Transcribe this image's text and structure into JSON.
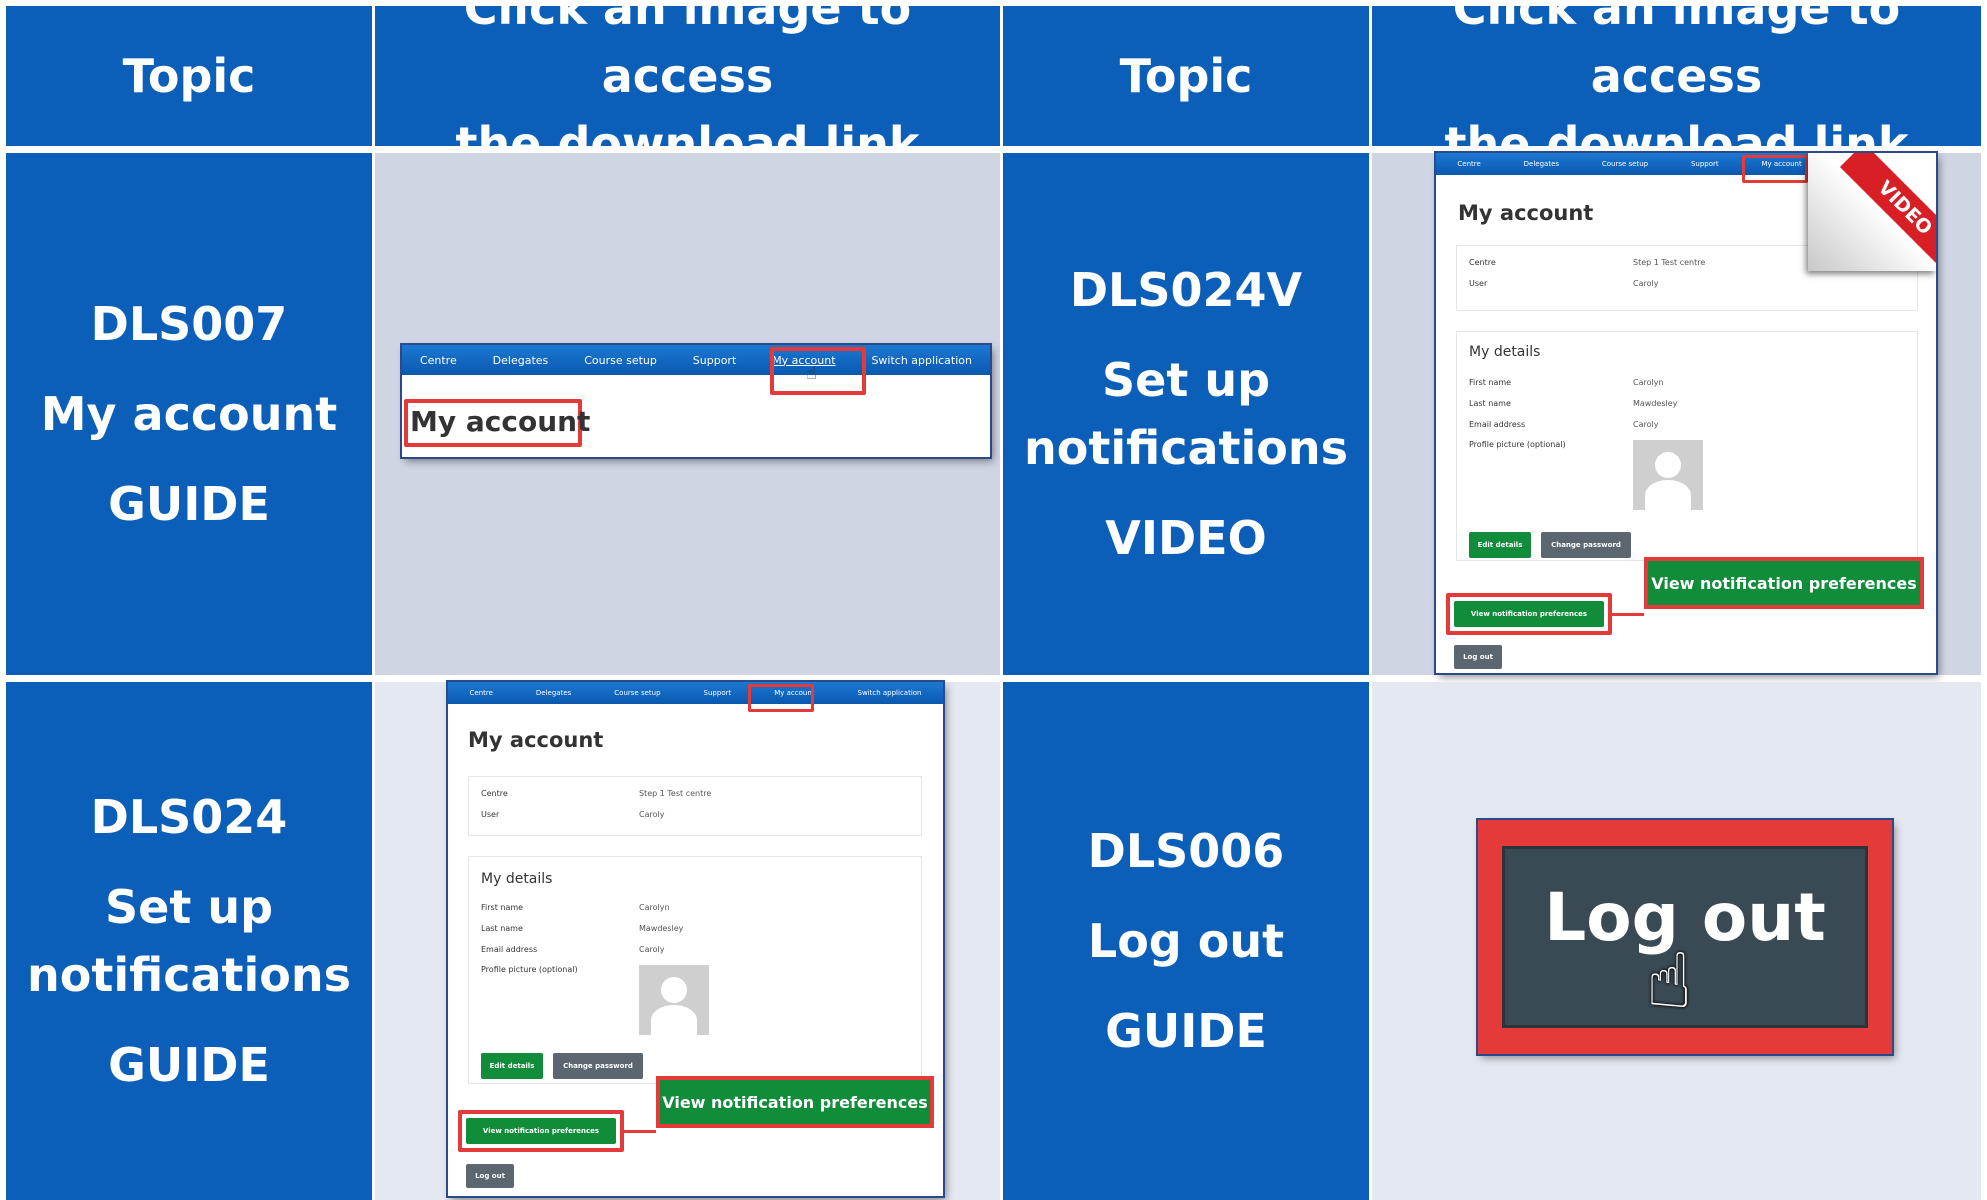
{
  "header": {
    "col1": "Topic",
    "col2_line1": "Click an image to access",
    "col2_line2": "the download link",
    "col3": "Topic",
    "col4_line1": "Click an image to access",
    "col4_line2": "the download link"
  },
  "rows": [
    {
      "code": "DLS007",
      "title_line1": "My account",
      "title_line2": "",
      "type": "GUIDE"
    },
    {
      "code": "DLS024V",
      "title_line1": "Set up",
      "title_line2": "notifications",
      "type": "VIDEO"
    },
    {
      "code": "DLS024",
      "title_line1": "Set up",
      "title_line2": "notifications",
      "type": "GUIDE"
    },
    {
      "code": "DLS006",
      "title_line1": "Log out",
      "title_line2": "",
      "type": "GUIDE"
    }
  ],
  "nav": [
    "Centre",
    "Delegates",
    "Course setup",
    "Support",
    "My account",
    "Switch application"
  ],
  "account": {
    "heading": "My account",
    "centre_label": "Centre",
    "centre_value": "Step 1 Test centre",
    "user_label": "User",
    "user_value": "Caroly",
    "details_heading": "My details",
    "first_name_label": "First name",
    "first_name_value": "Carolyn",
    "last_name_label": "Last name",
    "last_name_value": "Mawdesley",
    "email_label": "Email address",
    "email_value": "Caroly",
    "picture_label": "Profile picture (optional)",
    "edit_button": "Edit details",
    "change_password_button": "Change password",
    "view_notifications_button": "View notification preferences",
    "callout": "View notification preferences",
    "logout_button": "Log out"
  },
  "video_badge": "VIDEO",
  "logout_big": "Log out",
  "colors": {
    "header_blue": "#0b5fb8",
    "accent_red": "#e43a3a",
    "button_green": "#108c3a"
  }
}
